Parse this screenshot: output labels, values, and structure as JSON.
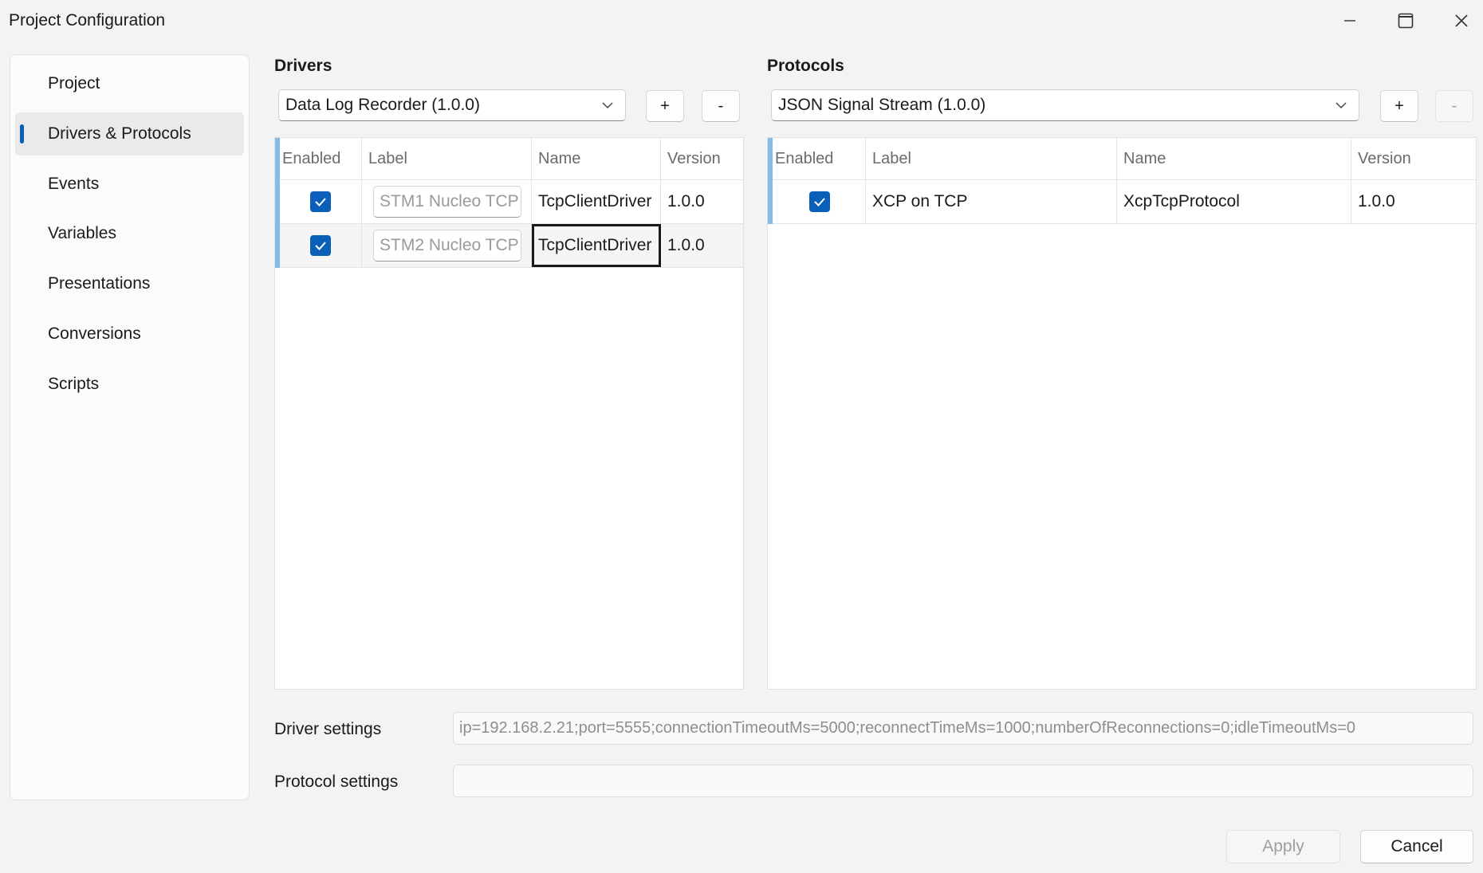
{
  "window": {
    "title": "Project Configuration"
  },
  "sidebar": {
    "items": [
      {
        "label": "Project"
      },
      {
        "label": "Drivers & Protocols"
      },
      {
        "label": "Events"
      },
      {
        "label": "Variables"
      },
      {
        "label": "Presentations"
      },
      {
        "label": "Conversions"
      },
      {
        "label": "Scripts"
      }
    ],
    "selected": "Drivers & Protocols"
  },
  "drivers": {
    "title": "Drivers",
    "combo_value": "Data Log Recorder (1.0.0)",
    "add_label": "+",
    "remove_label": "-",
    "columns": [
      "Enabled",
      "Label",
      "Name",
      "Version"
    ],
    "rows": [
      {
        "enabled": true,
        "label": "STM1 Nucleo TCP",
        "name": "TcpClientDriver",
        "version": "1.0.0"
      },
      {
        "enabled": true,
        "label": "STM2 Nucleo TCP",
        "name": "TcpClientDriver",
        "version": "1.0.0"
      }
    ]
  },
  "protocols": {
    "title": "Protocols",
    "combo_value": "JSON Signal Stream (1.0.0)",
    "add_label": "+",
    "remove_label": "-",
    "columns": [
      "Enabled",
      "Label",
      "Name",
      "Version"
    ],
    "rows": [
      {
        "enabled": true,
        "label": "XCP on TCP",
        "name": "XcpTcpProtocol",
        "version": "1.0.0"
      }
    ]
  },
  "settings": {
    "driver_label": "Driver settings",
    "driver_value": "ip=192.168.2.21;port=5555;connectionTimeoutMs=5000;reconnectTimeMs=1000;numberOfReconnections=0;idleTimeoutMs=0",
    "protocol_label": "Protocol settings",
    "protocol_value": ""
  },
  "footer": {
    "apply_label": "Apply",
    "cancel_label": "Cancel"
  },
  "colors": {
    "accent": "#0a5fb8",
    "row_accent": "#86bbe6"
  }
}
